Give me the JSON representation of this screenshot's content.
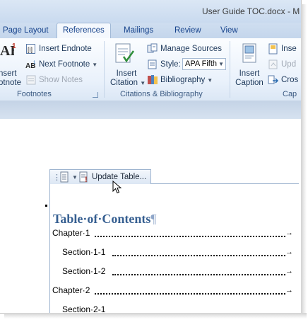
{
  "window": {
    "title": "User Guide TOC.docx - M"
  },
  "tabs": [
    {
      "label": "Page Layout",
      "active": false
    },
    {
      "label": "References",
      "active": true
    },
    {
      "label": "Mailings",
      "active": false
    },
    {
      "label": "Review",
      "active": false
    },
    {
      "label": "View",
      "active": false
    }
  ],
  "ribbon": {
    "footnotes": {
      "insert_footnote_line1": "nsert",
      "insert_footnote_line2": "otnote",
      "insert_endnote": "Insert Endnote",
      "next_footnote": "Next Footnote",
      "show_notes": "Show Notes",
      "group_label": "Footnotes"
    },
    "citations": {
      "insert_citation_line1": "Insert",
      "insert_citation_line2": "Citation",
      "manage_sources": "Manage Sources",
      "style_label": "Style:",
      "style_value": "APA Fifth",
      "bibliography": "Bibliography",
      "group_label": "Citations & Bibliography"
    },
    "captions": {
      "insert_caption_line1": "Insert",
      "insert_caption_line2": "Caption",
      "insert_table_of_figures": "Inse",
      "update_table": "Upd",
      "cross_reference": "Cros",
      "group_label": "Cap"
    }
  },
  "content_control": {
    "update_table_label": "Update Table..."
  },
  "document": {
    "toc_title": "Table·of·Contents",
    "pilcrow": "¶",
    "entries": [
      {
        "text": "Chapter·1"
      },
      {
        "text": "Section·1-1"
      },
      {
        "text": "Section·1-2"
      },
      {
        "text": "Chapter·2"
      },
      {
        "text": "Section·2-1"
      }
    ]
  },
  "colors": {
    "heading": "#365f91",
    "ribbon_text": "#1e395b",
    "tab_text": "#15428b"
  }
}
